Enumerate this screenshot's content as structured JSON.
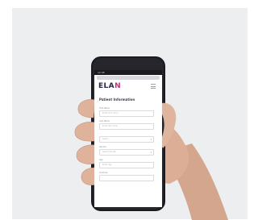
{
  "phone": {
    "status_time": "12:45",
    "logo": {
      "part_a": "ELA",
      "part_b": "N"
    },
    "heading": "Patient Information",
    "fields": [
      {
        "label": "First Name",
        "value": "Enter first name"
      },
      {
        "label": "Last Name",
        "value": "Enter last name"
      },
      {
        "label": "",
        "value": "Select"
      },
      {
        "label": "Gender",
        "value": "Select Gender"
      },
      {
        "label": "Age",
        "value": "Enter age"
      },
      {
        "label": "Continue",
        "value": ""
      }
    ]
  },
  "colors": {
    "background": "#eceef0",
    "brand_dark": "#2c2347",
    "brand_accent": "#c2337a"
  }
}
